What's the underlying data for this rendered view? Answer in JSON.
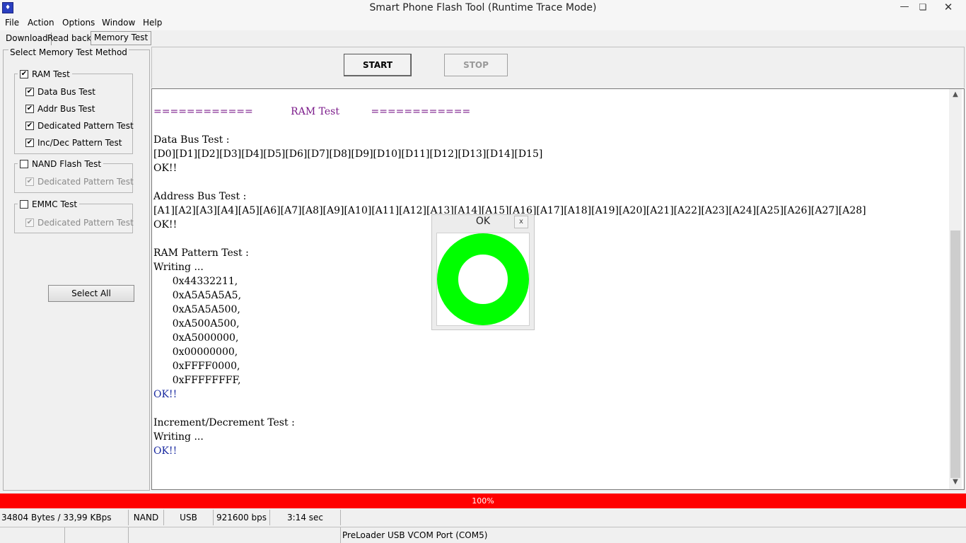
{
  "window": {
    "title": "Smart Phone Flash Tool (Runtime Trace Mode)",
    "minimize": "—",
    "maximize": "❏",
    "close": "✕"
  },
  "menu": [
    "File",
    "Action",
    "Options",
    "Window",
    "Help"
  ],
  "tabs": [
    "Download",
    "Read back",
    "Memory Test"
  ],
  "active_tab": "Memory Test",
  "left_panel": {
    "title": "Select Memory Test Method",
    "ram": {
      "label": "RAM Test",
      "checked": true,
      "options": [
        {
          "label": "Data Bus Test",
          "checked": true
        },
        {
          "label": "Addr Bus Test",
          "checked": true
        },
        {
          "label": "Dedicated Pattern Test",
          "checked": true
        },
        {
          "label": "Inc/Dec Pattern Test",
          "checked": true
        }
      ]
    },
    "nand": {
      "label": "NAND Flash Test",
      "checked": false,
      "option": "Dedicated Pattern Test"
    },
    "emmc": {
      "label": "EMMC Test",
      "checked": false,
      "option": "Dedicated Pattern Test"
    },
    "select_all": "Select All"
  },
  "buttons": {
    "start": "START",
    "stop": "STOP"
  },
  "log": {
    "header_left": "============",
    "header_mid": "RAM Test",
    "header_right": "============",
    "data_bus_title": "Data Bus Test :",
    "data_bus_line": "[D0][D1][D2][D3][D4][D5][D6][D7][D8][D9][D10][D11][D12][D13][D14][D15]",
    "ok": "OK!!",
    "addr_bus_title": "Address Bus Test :",
    "addr_bus_line": "[A1][A2][A3][A4][A5][A6][A7][A8][A9][A10][A11][A12][A13][A14][A15][A16][A17][A18][A19][A20][A21][A22][A23][A24][A25][A26][A27][A28]",
    "pattern_title": "RAM Pattern Test :",
    "writing": "Writing ...",
    "patterns": [
      "0x44332211,",
      "0xA5A5A5A5,",
      "0xA5A5A500,",
      "0xA500A500,",
      "0xA5000000,",
      "0x00000000,",
      "0xFFFF0000,",
      "0xFFFFFFFF,"
    ],
    "incdec_title": "Increment/Decrement Test :"
  },
  "ok_dialog": {
    "title": "OK",
    "close": "x",
    "ring_color": "#00ff00"
  },
  "progress": {
    "value": 100,
    "label": "100%",
    "color": "#ff0000"
  },
  "status": {
    "bytes": "34804 Bytes / 33,99 KBps",
    "storage": "NAND",
    "conn": "USB",
    "baud": "921600 bps",
    "time": "3:14 sec",
    "port": "PreLoader USB VCOM Port (COM5)"
  }
}
